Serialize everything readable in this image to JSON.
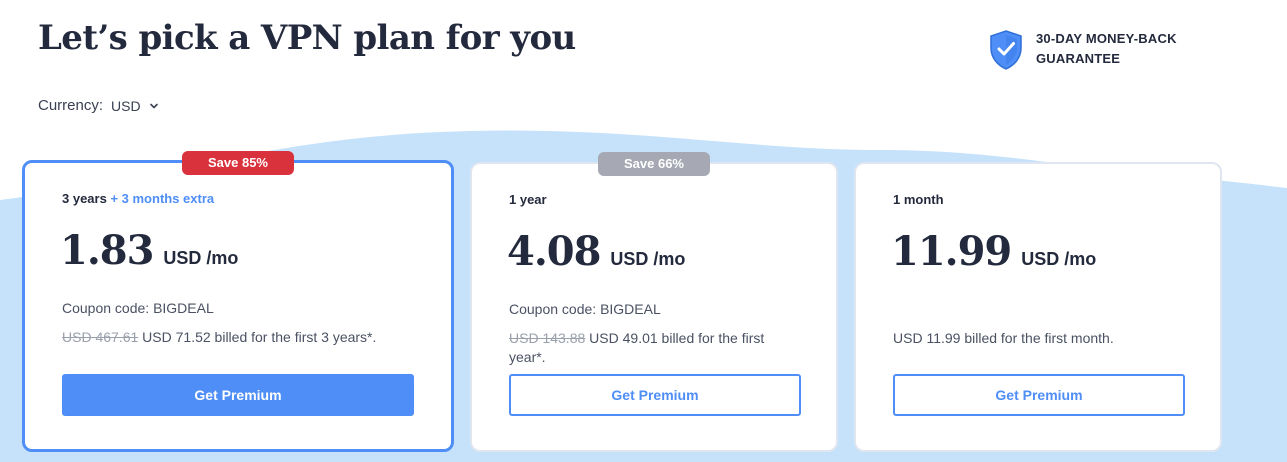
{
  "header": {
    "title": "Let’s pick a VPN plan for you",
    "guarantee_line1": "30-DAY MONEY-BACK",
    "guarantee_line2": "GUARANTEE"
  },
  "currency": {
    "label": "Currency:",
    "value": "USD"
  },
  "plans": [
    {
      "badge": "Save 85%",
      "term": "3 years",
      "extra": "+ 3 months extra",
      "price": "1.83",
      "unit": "USD /mo",
      "coupon": "Coupon code: BIGDEAL",
      "old_price": "USD 467.61",
      "billing": " USD 71.52 billed for the first 3 years*.",
      "button": "Get Premium"
    },
    {
      "badge": "Save 66%",
      "term": "1 year",
      "price": "4.08",
      "unit": "USD /mo",
      "coupon": "Coupon code: BIGDEAL",
      "old_price": "USD 143.88",
      "billing": " USD 49.01 billed for the first year*.",
      "button": "Get Premium"
    },
    {
      "term": "1 month",
      "price": "11.99",
      "unit": "USD /mo",
      "billing": "USD 11.99 billed for the first month.",
      "button": "Get Premium"
    }
  ],
  "colors": {
    "accent": "#4f8ef7",
    "save_red": "#d9323d",
    "save_grey": "#a6a9b3",
    "wave": "#c6e2fb"
  },
  "icons": {
    "guarantee": "shield-check-icon",
    "currency_toggle": "chevron-down-icon"
  }
}
